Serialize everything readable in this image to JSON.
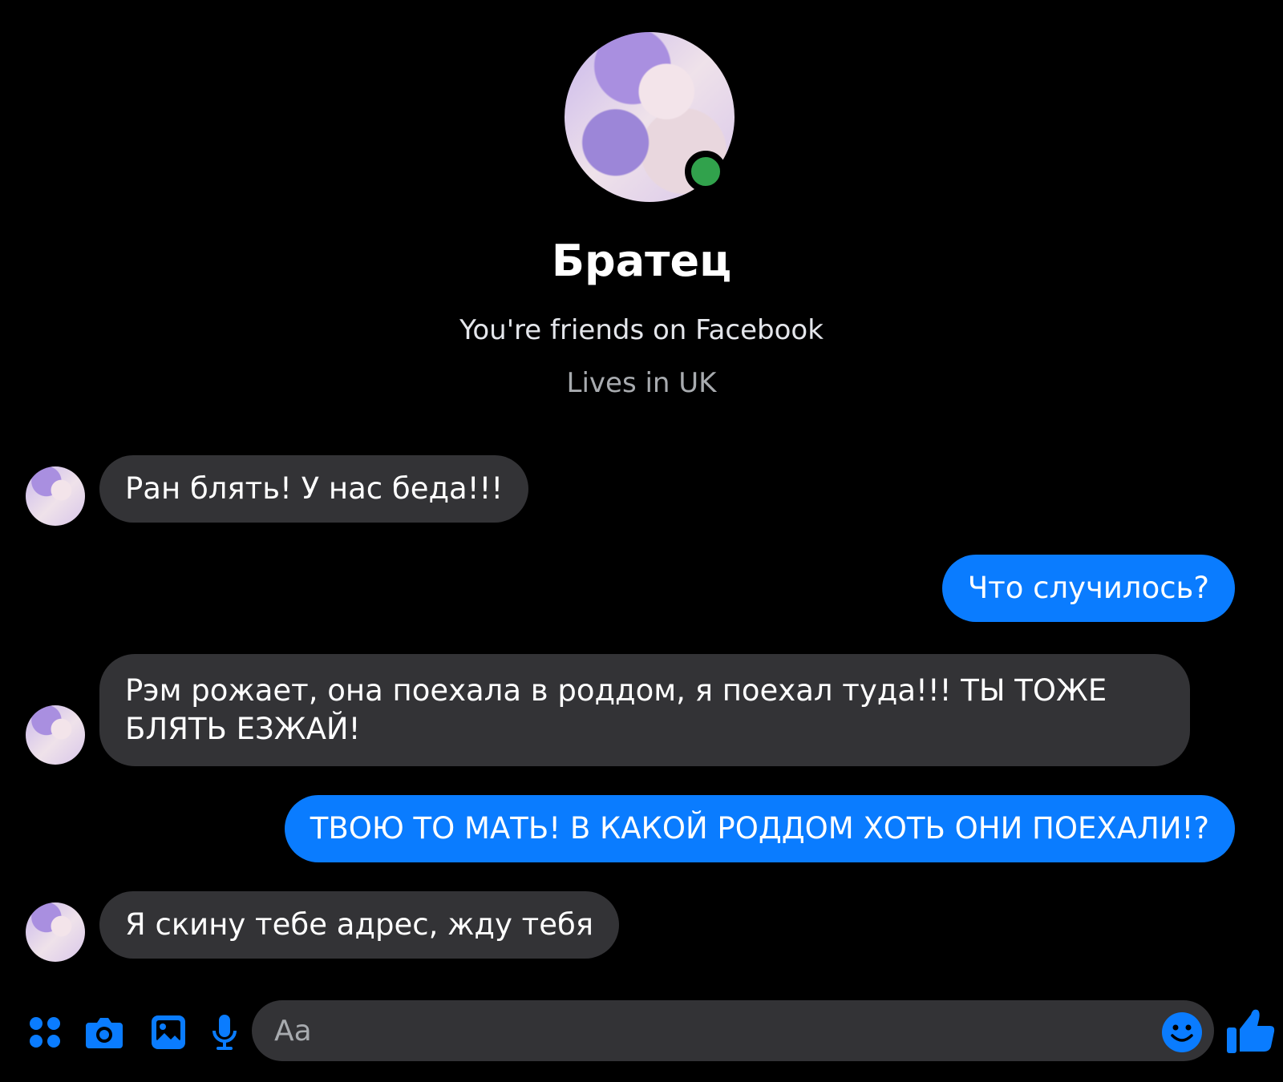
{
  "colors": {
    "background": "#000000",
    "incoming_bubble": "#333336",
    "outgoing_bubble": "#0a7cff",
    "accent": "#0a7cff",
    "online": "#31a24c"
  },
  "profile": {
    "name": "Братец",
    "friend_status": "You're friends on Facebook",
    "location": "Lives in UK"
  },
  "messages": [
    {
      "direction": "incoming",
      "text": "Ран блять! У нас беда!!!"
    },
    {
      "direction": "outgoing",
      "text": "Что случилось?"
    },
    {
      "direction": "incoming",
      "text": "Рэм рожает, она поехала в роддом, я поехал туда!!! ТЫ ТОЖЕ БЛЯТЬ ЕЗЖАЙ!"
    },
    {
      "direction": "outgoing",
      "text": "ТВОЮ ТО МАТЬ! В КАКОЙ РОДДОМ ХОТЬ ОНИ ПОЕХАЛИ!?"
    },
    {
      "direction": "incoming",
      "text": "Я скину тебе адрес, жду тебя"
    }
  ],
  "composer": {
    "placeholder": "Aa",
    "icons": [
      "menu-grid-icon",
      "camera-icon",
      "gallery-icon",
      "microphone-icon",
      "emoji-icon",
      "thumbs-up-icon"
    ]
  }
}
